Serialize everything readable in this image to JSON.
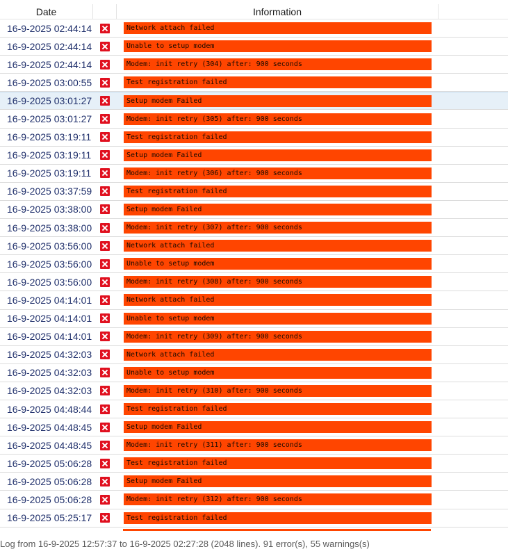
{
  "columns": {
    "date": "Date",
    "icon": "",
    "information": "Information"
  },
  "colors": {
    "error_bar": "#ff4500",
    "error_icon": "#e0101f",
    "date_text": "#1f2f6b",
    "selected_row": "#e6f0f8"
  },
  "rows": [
    {
      "date": "16-9-2025 02:44:14",
      "icon": "error-icon",
      "message": "Network attach failed"
    },
    {
      "date": "16-9-2025 02:44:14",
      "icon": "error-icon",
      "message": "Unable to setup modem"
    },
    {
      "date": "16-9-2025 02:44:14",
      "icon": "error-icon",
      "message": "Modem: init retry (304) after: 900 seconds"
    },
    {
      "date": "16-9-2025 03:00:55",
      "icon": "error-icon",
      "message": "Test registration failed"
    },
    {
      "date": "16-9-2025 03:01:27",
      "icon": "error-icon",
      "message": "Setup modem Failed"
    },
    {
      "date": "16-9-2025 03:01:27",
      "icon": "error-icon",
      "message": "Modem: init retry (305) after: 900 seconds"
    },
    {
      "date": "16-9-2025 03:19:11",
      "icon": "error-icon",
      "message": "Test registration failed"
    },
    {
      "date": "16-9-2025 03:19:11",
      "icon": "error-icon",
      "message": "Setup modem Failed"
    },
    {
      "date": "16-9-2025 03:19:11",
      "icon": "error-icon",
      "message": "Modem: init retry (306) after: 900 seconds"
    },
    {
      "date": "16-9-2025 03:37:59",
      "icon": "error-icon",
      "message": "Test registration failed"
    },
    {
      "date": "16-9-2025 03:38:00",
      "icon": "error-icon",
      "message": "Setup modem Failed"
    },
    {
      "date": "16-9-2025 03:38:00",
      "icon": "error-icon",
      "message": "Modem: init retry (307) after: 900 seconds"
    },
    {
      "date": "16-9-2025 03:56:00",
      "icon": "error-icon",
      "message": "Network attach failed"
    },
    {
      "date": "16-9-2025 03:56:00",
      "icon": "error-icon",
      "message": "Unable to setup modem"
    },
    {
      "date": "16-9-2025 03:56:00",
      "icon": "error-icon",
      "message": "Modem: init retry (308) after: 900 seconds"
    },
    {
      "date": "16-9-2025 04:14:01",
      "icon": "error-icon",
      "message": "Network attach failed"
    },
    {
      "date": "16-9-2025 04:14:01",
      "icon": "error-icon",
      "message": "Unable to setup modem"
    },
    {
      "date": "16-9-2025 04:14:01",
      "icon": "error-icon",
      "message": "Modem: init retry (309) after: 900 seconds"
    },
    {
      "date": "16-9-2025 04:32:03",
      "icon": "error-icon",
      "message": "Network attach failed"
    },
    {
      "date": "16-9-2025 04:32:03",
      "icon": "error-icon",
      "message": "Unable to setup modem"
    },
    {
      "date": "16-9-2025 04:32:03",
      "icon": "error-icon",
      "message": "Modem: init retry (310) after: 900 seconds"
    },
    {
      "date": "16-9-2025 04:48:44",
      "icon": "error-icon",
      "message": "Test registration failed"
    },
    {
      "date": "16-9-2025 04:48:45",
      "icon": "error-icon",
      "message": "Setup modem Failed"
    },
    {
      "date": "16-9-2025 04:48:45",
      "icon": "error-icon",
      "message": "Modem: init retry (311) after: 900 seconds"
    },
    {
      "date": "16-9-2025 05:06:28",
      "icon": "error-icon",
      "message": "Test registration failed"
    },
    {
      "date": "16-9-2025 05:06:28",
      "icon": "error-icon",
      "message": "Setup modem Failed"
    },
    {
      "date": "16-9-2025 05:06:28",
      "icon": "error-icon",
      "message": "Modem: init retry (312) after: 900 seconds"
    },
    {
      "date": "16-9-2025 05:25:17",
      "icon": "error-icon",
      "message": "Test registration failed"
    }
  ],
  "status_bar": {
    "text": "Log from 16-9-2025 12:57:37 to 16-9-2025 02:27:28 (2048 lines). 91 error(s), 55 warnings(s)"
  }
}
